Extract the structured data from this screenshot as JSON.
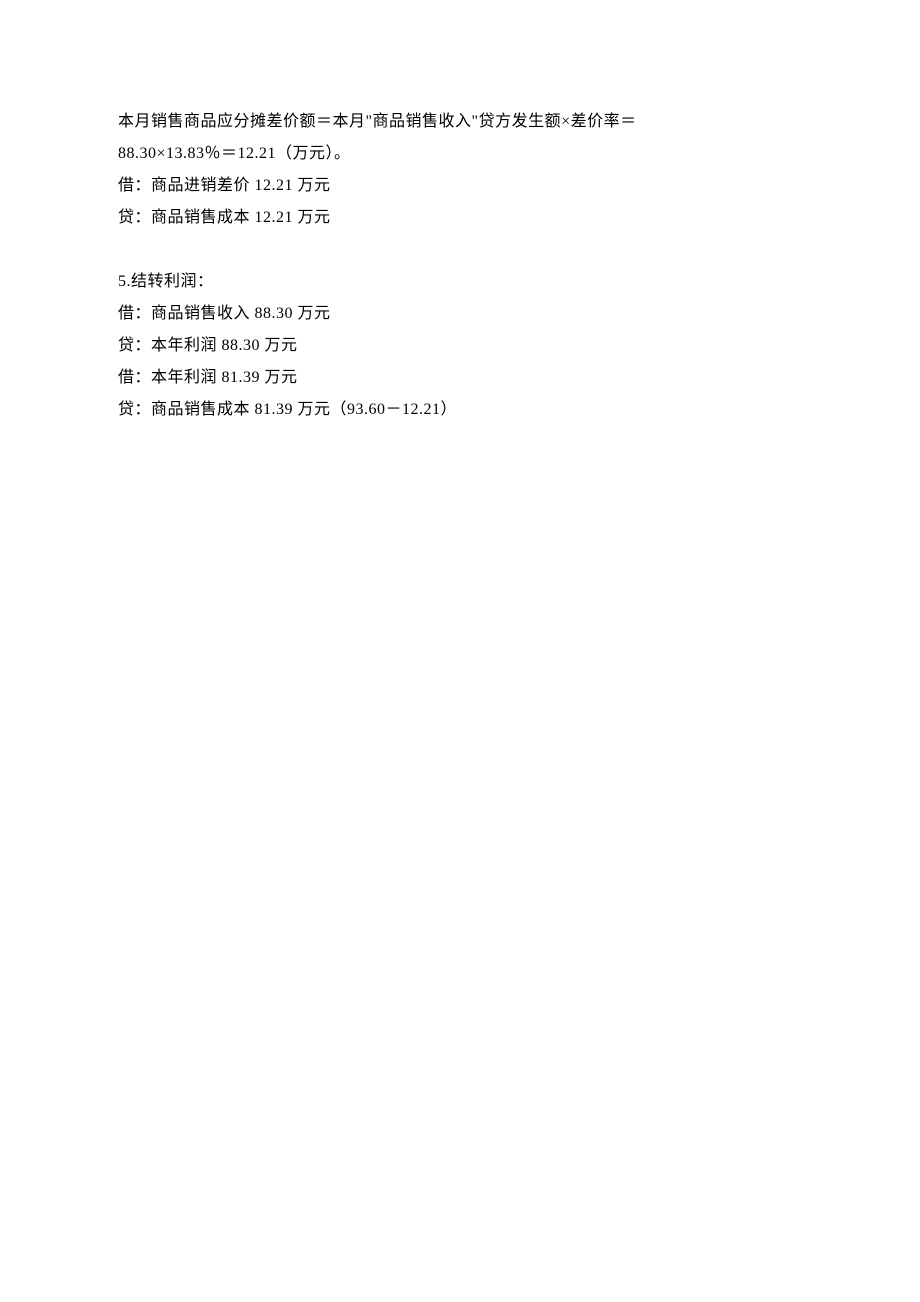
{
  "lines": {
    "l1": "本月销售商品应分摊差价额＝本月\"商品销售收入\"贷方发生额×差价率＝",
    "l2": "88.30×13.83％＝12.21（万元）。",
    "l3": "借：商品进销差价 12.21 万元",
    "l4": "贷：商品销售成本 12.21 万元",
    "l5": "5.结转利润：",
    "l6": "借：商品销售收入 88.30 万元",
    "l7": "贷：本年利润 88.30 万元",
    "l8": "借：本年利润 81.39 万元",
    "l9": "贷：商品销售成本 81.39 万元（93.60－12.21）"
  }
}
